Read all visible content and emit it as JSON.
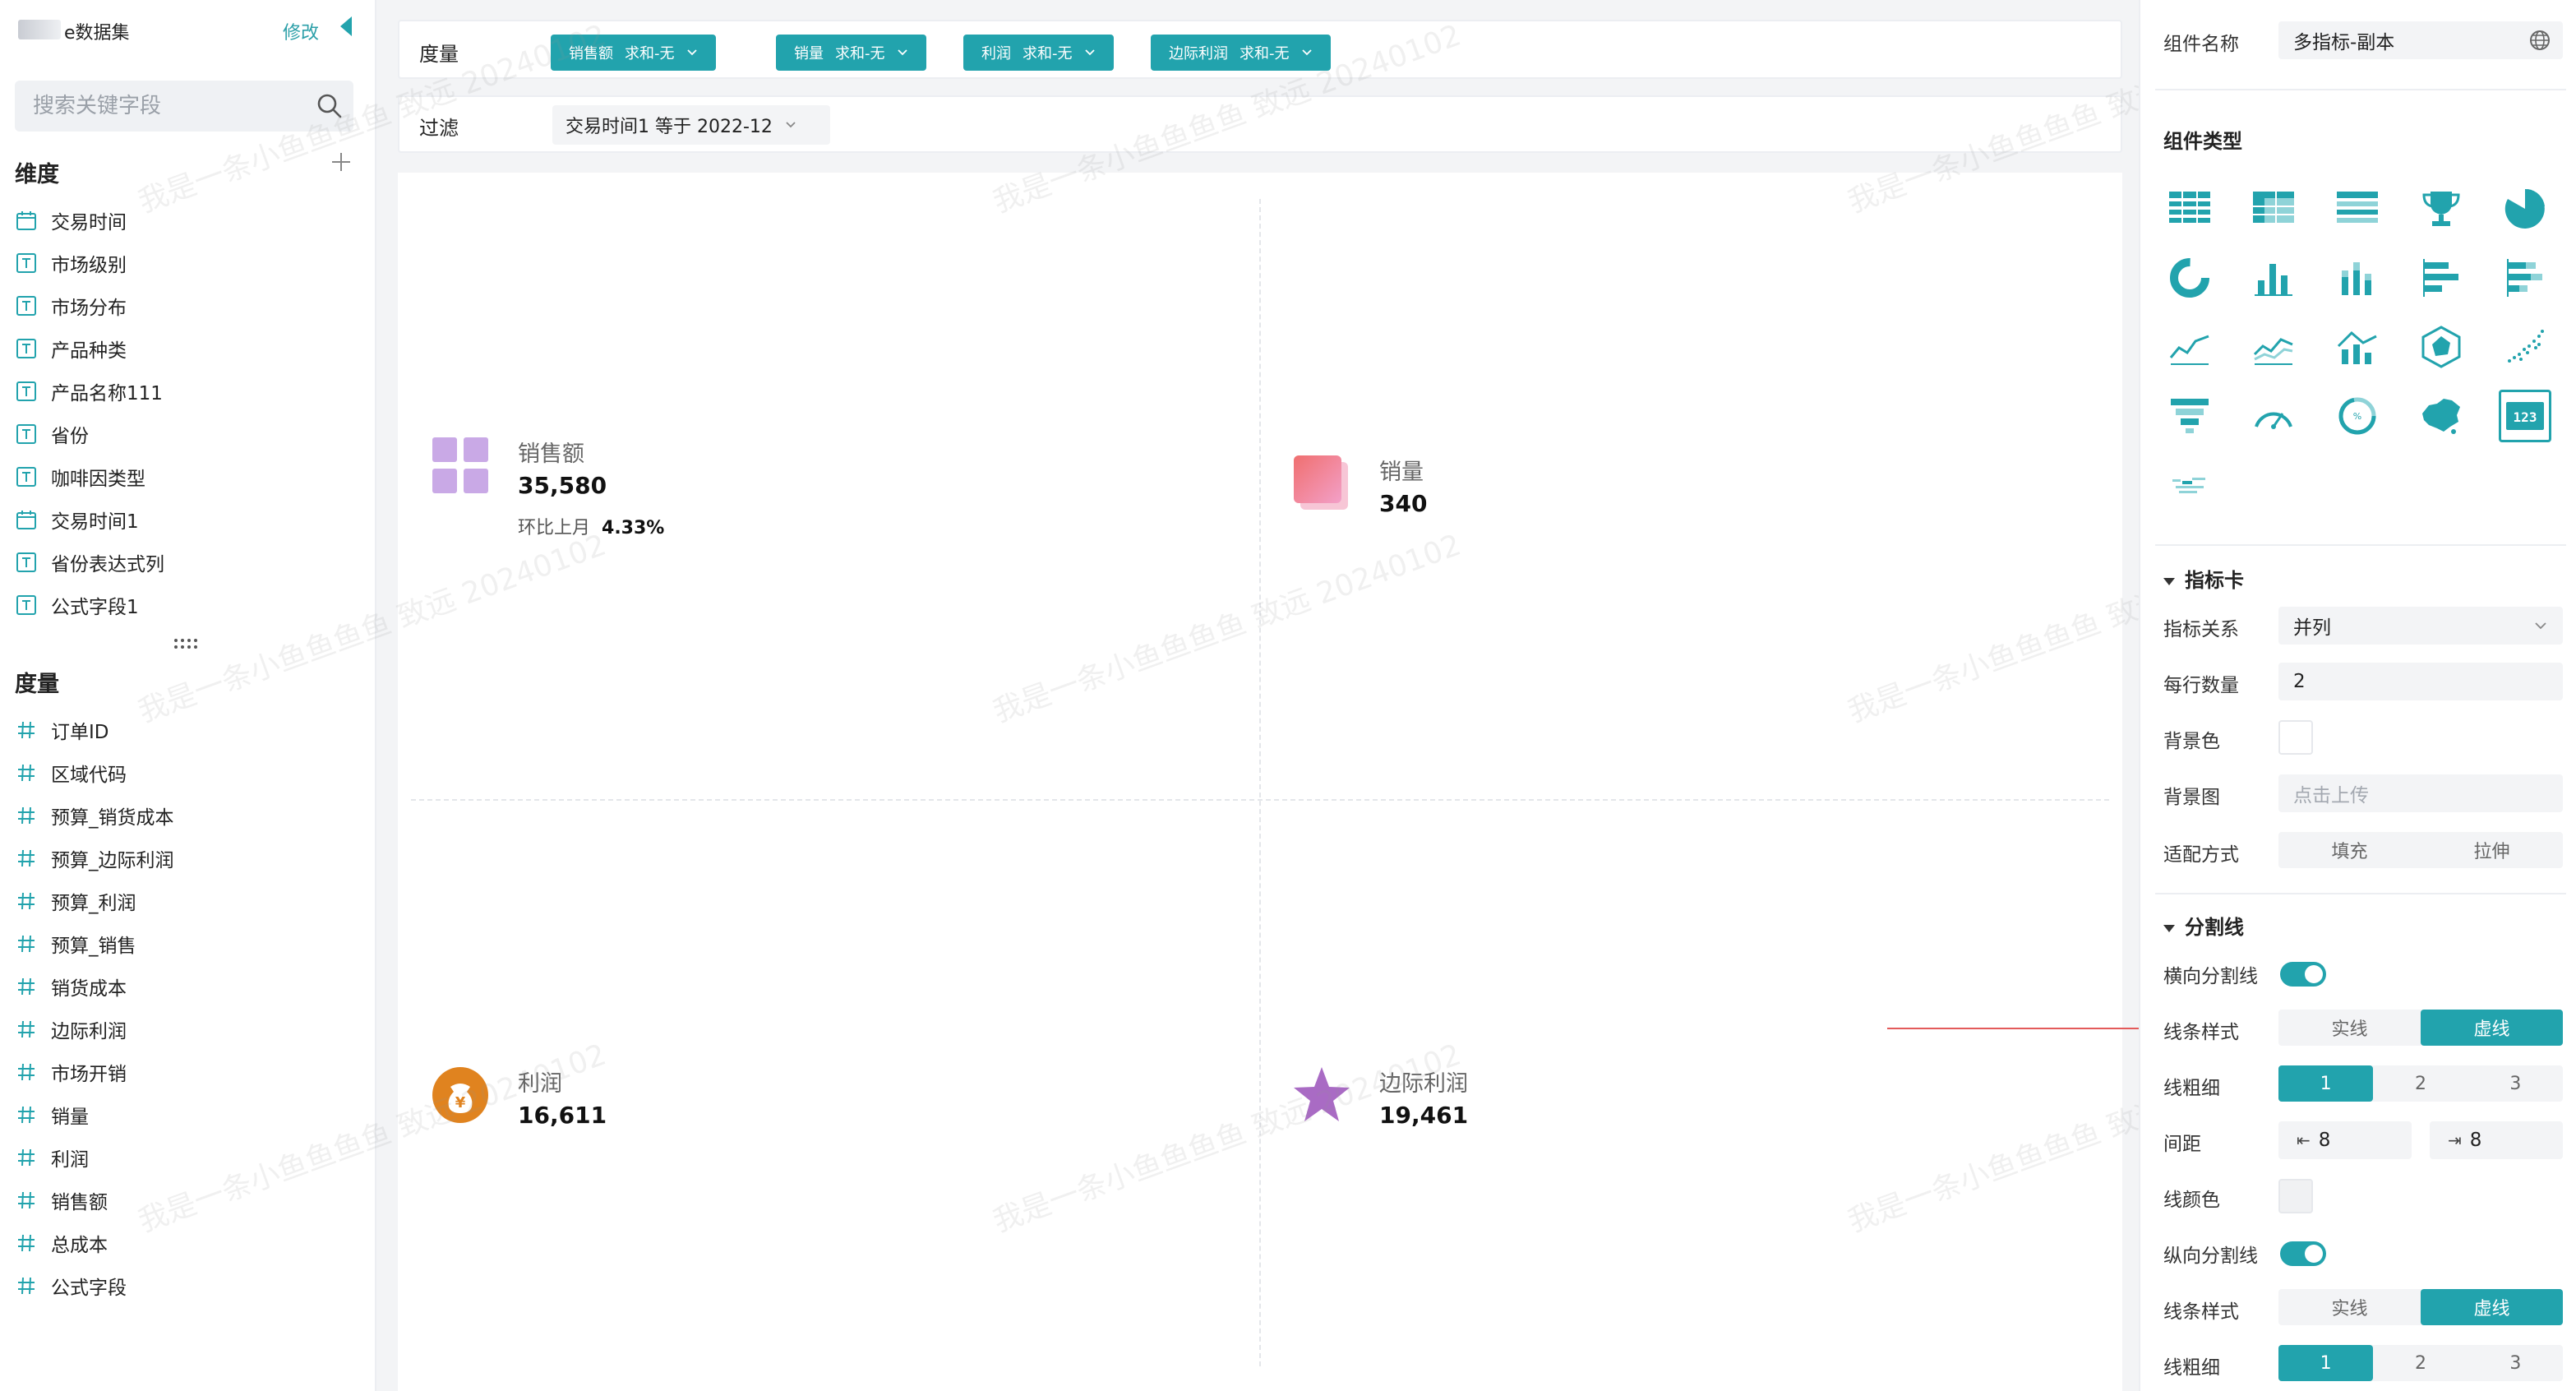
{
  "colors": {
    "accent": "#22a3ad",
    "annotation_arrow": "#e35a5a"
  },
  "dataset": {
    "title": "e数据集",
    "edit_label": "修改"
  },
  "search": {
    "placeholder": "搜索关键字段"
  },
  "dimensions": {
    "title": "维度",
    "items": [
      {
        "label": "交易时间",
        "icon": "calendar-icon"
      },
      {
        "label": "市场级别",
        "icon": "text-field-icon"
      },
      {
        "label": "市场分布",
        "icon": "text-field-icon"
      },
      {
        "label": "产品种类",
        "icon": "text-field-icon"
      },
      {
        "label": "产品名称111",
        "icon": "text-field-icon"
      },
      {
        "label": "省份",
        "icon": "text-field-icon"
      },
      {
        "label": "咖啡因类型",
        "icon": "text-field-icon"
      },
      {
        "label": "交易时间1",
        "icon": "calendar-icon"
      },
      {
        "label": "省份表达式列",
        "icon": "text-field-icon"
      },
      {
        "label": "公式字段1",
        "icon": "text-field-icon"
      }
    ]
  },
  "measures": {
    "title": "度量",
    "items": [
      {
        "label": "订单ID"
      },
      {
        "label": "区域代码"
      },
      {
        "label": "预算_销货成本"
      },
      {
        "label": "预算_边际利润"
      },
      {
        "label": "预算_利润"
      },
      {
        "label": "预算_销售"
      },
      {
        "label": "销货成本"
      },
      {
        "label": "边际利润"
      },
      {
        "label": "市场开销"
      },
      {
        "label": "销量"
      },
      {
        "label": "利润"
      },
      {
        "label": "销售额"
      },
      {
        "label": "总成本"
      },
      {
        "label": "公式字段"
      }
    ]
  },
  "measure_bar": {
    "label": "度量",
    "pills": [
      {
        "field": "销售额",
        "agg": "求和-无"
      },
      {
        "field": "销量",
        "agg": "求和-无"
      },
      {
        "field": "利润",
        "agg": "求和-无"
      },
      {
        "field": "边际利润",
        "agg": "求和-无"
      }
    ]
  },
  "filter_bar": {
    "label": "过滤",
    "chip": "交易时间1 等于 2022-12"
  },
  "kpis": [
    {
      "name": "销售额",
      "value": "35,580",
      "compare_label": "环比上月",
      "compare_value": "4.33%",
      "icon": "grid-icon"
    },
    {
      "name": "销量",
      "value": "340",
      "icon": "layers-icon"
    },
    {
      "name": "利润",
      "value": "16,611",
      "icon": "money-bag-icon"
    },
    {
      "name": "边际利润",
      "value": "19,461",
      "icon": "star-icon"
    }
  ],
  "watermark_text": "我是一条小鱼鱼鱼鱼 致远 20240102",
  "panel": {
    "component_name_label": "组件名称",
    "component_name_value": "多指标-副本",
    "component_type_title": "组件类型",
    "selected_type_icon": "number-card-icon",
    "kpi_section": {
      "title": "指标卡",
      "relation_label": "指标关系",
      "relation_value": "并列",
      "per_row_label": "每行数量",
      "per_row_value": "2",
      "bg_color_label": "背景色",
      "bg_image_label": "背景图",
      "bg_image_placeholder": "点击上传",
      "fit_label": "适配方式",
      "fit_options": [
        "填充",
        "拉伸"
      ]
    },
    "divider_section": {
      "title": "分割线",
      "h_divider_label": "横向分割线",
      "h_divider_on": true,
      "line_style_label": "线条样式",
      "line_style_options": [
        "实线",
        "虚线"
      ],
      "line_style_selected": "虚线",
      "thickness_label": "线粗细",
      "thickness_options": [
        "1",
        "2",
        "3"
      ],
      "thickness_selected": "1",
      "spacing_label": "间距",
      "spacing_left": "8",
      "spacing_right": "8",
      "line_color_label": "线颜色",
      "v_divider_label": "纵向分割线",
      "v_divider_on": true,
      "v_line_style_label": "线条样式",
      "v_line_style_options": [
        "实线",
        "虚线"
      ],
      "v_line_style_selected": "虚线",
      "v_thickness_label": "线粗细",
      "v_thickness_options": [
        "1",
        "2",
        "3"
      ],
      "v_thickness_selected": "1"
    }
  }
}
